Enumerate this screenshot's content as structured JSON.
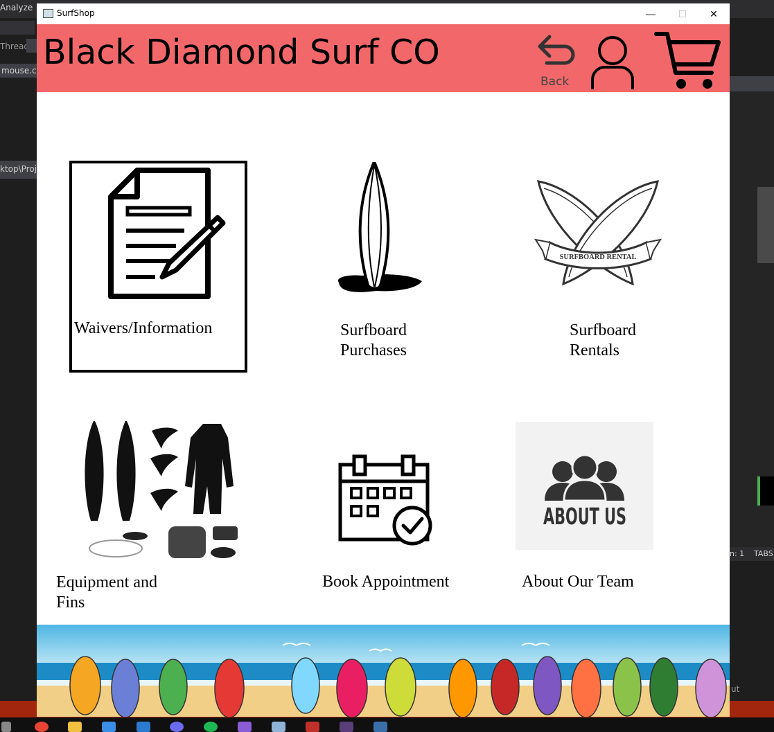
{
  "background_ide": {
    "menu_item": "Analyze",
    "thread_label": "Thread:",
    "file_tab": "mouse.cpp",
    "path_fragment": "ktop\\Proje",
    "status_col": "n: 1",
    "status_tabs": "TABS",
    "output_fragment": "ut"
  },
  "window": {
    "title": "SurfShop",
    "minimize_glyph": "—",
    "maximize_glyph": "☐",
    "close_glyph": "✕"
  },
  "header": {
    "brand": "Black Diamond Surf CO",
    "back_label": "Back",
    "color": "#f2686a"
  },
  "tiles": [
    {
      "id": "waivers",
      "label_line1": "Waivers/Information",
      "label_line2": "",
      "icon": "document-pencil-icon"
    },
    {
      "id": "purchases",
      "label_line1": "Surfboard",
      "label_line2": "Purchases",
      "icon": "surfboard-icon"
    },
    {
      "id": "rentals",
      "label_line1": "Surfboard Rentals",
      "label_line2": "",
      "icon": "surfboard-rental-icon",
      "badge_text": "SURFBOARD RENTAL"
    },
    {
      "id": "equipment",
      "label_line1": "Equipment and",
      "label_line2": "Fins",
      "icon": "surf-equipment-icon"
    },
    {
      "id": "appointment",
      "label_line1": "Book Appointment",
      "label_line2": "",
      "icon": "calendar-check-icon"
    },
    {
      "id": "about",
      "label_line1": "About Our Team",
      "label_line2": "",
      "icon": "about-us-icon",
      "badge_text": "ABOUT US"
    }
  ]
}
